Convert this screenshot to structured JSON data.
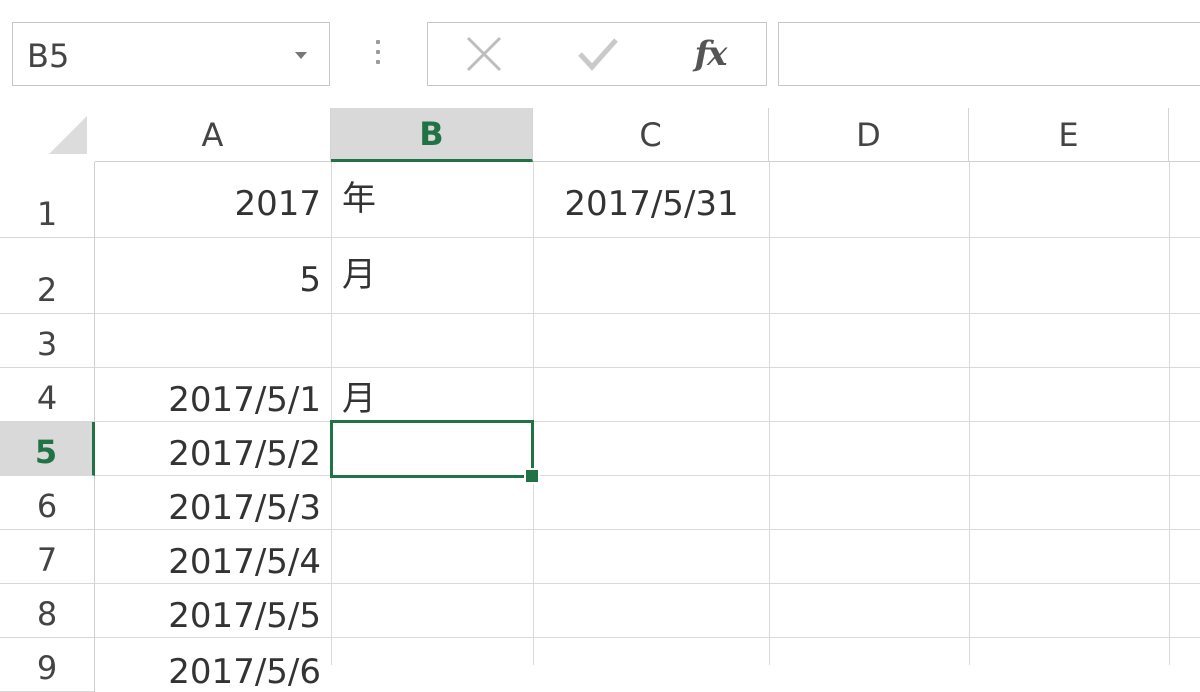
{
  "namebox": {
    "value": "B5"
  },
  "formula_buttons": {
    "cancel_icon": "x-icon",
    "enter_icon": "check-icon",
    "fx_label": "fx"
  },
  "formula_bar": {
    "value": ""
  },
  "columns": [
    "A",
    "B",
    "C",
    "D",
    "E"
  ],
  "selected_column": "B",
  "rows": [
    "1",
    "2",
    "3",
    "4",
    "5",
    "6",
    "7",
    "8",
    "9"
  ],
  "selected_row": "5",
  "cells": {
    "A1": "2017",
    "B1": "年",
    "C1": "2017/5/31",
    "A2": "5",
    "B2": "月",
    "A4": "2017/5/1",
    "B4": "月",
    "A5": "2017/5/2",
    "A6": "2017/5/3",
    "A7": "2017/5/4",
    "A8": "2017/5/5",
    "A9": "2017/5/6"
  },
  "colors": {
    "accent": "#217346",
    "header_selected_bg": "#d9d9d9",
    "gridline": "#dadada"
  }
}
